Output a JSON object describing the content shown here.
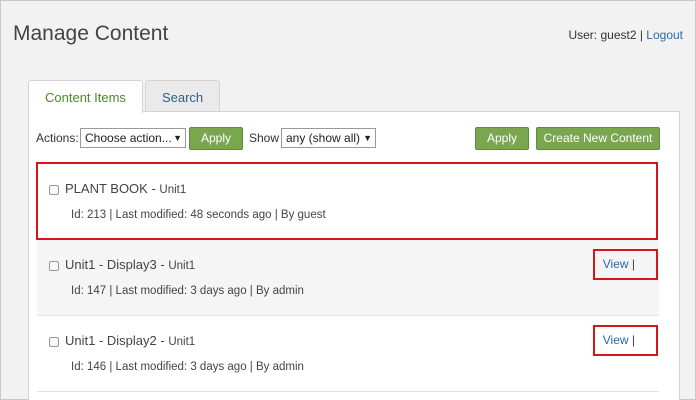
{
  "header": {
    "title": "Manage Content",
    "user_prefix": "User: ",
    "username": "guest2",
    "separator": " | ",
    "logout": "Logout"
  },
  "tabs": [
    {
      "label": "Content Items",
      "active": true
    },
    {
      "label": "Search",
      "active": false
    }
  ],
  "toolbar": {
    "actions_label": "Actions:",
    "actions_value": "Choose action...",
    "apply_label": "Apply",
    "show_label": "Show",
    "show_value": "any (show all)",
    "apply2_label": "Apply",
    "create_label": "Create New Content"
  },
  "items": [
    {
      "title": "PLANT BOOK",
      "dash": " - ",
      "unit": "Unit1",
      "meta": "Id: 213 | Last modified: 48 seconds ago | By guest"
    },
    {
      "title": "Unit1 - Display3",
      "dash": " - ",
      "unit": "Unit1",
      "meta": "Id: 147 | Last modified: 3 days ago | By admin",
      "view": "View",
      "view_sep": " |"
    },
    {
      "title": "Unit1 - Display2",
      "dash": " - ",
      "unit": "Unit1",
      "meta": "Id: 146 | Last modified: 3 days ago | By admin",
      "view": "View",
      "view_sep": " |"
    }
  ],
  "colors": {
    "accent_green": "#79a64f",
    "link_blue": "#2a6aa8",
    "highlight_red": "#d4161c"
  }
}
